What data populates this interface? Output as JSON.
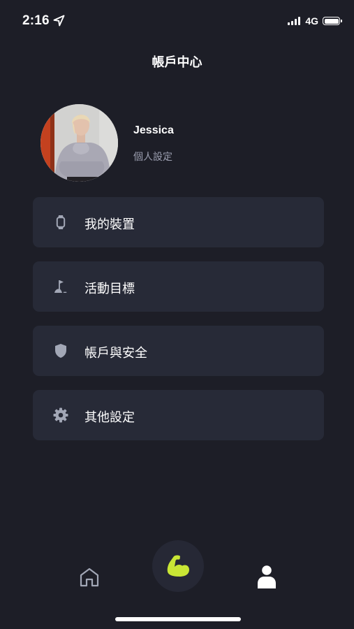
{
  "status_bar": {
    "time": "2:16",
    "network": "4G",
    "location_icon": "location-arrow-icon",
    "signal_icon": "signal-bars-icon",
    "battery_icon": "battery-icon",
    "battery_level": 1.0
  },
  "header": {
    "title": "帳戶中心"
  },
  "profile": {
    "name": "Jessica",
    "subtitle": "個人設定",
    "avatar_icon": "user-photo"
  },
  "menu": {
    "items": [
      {
        "label": "我的裝置",
        "icon": "smartwatch-icon"
      },
      {
        "label": "活動目標",
        "icon": "flag-goal-icon"
      },
      {
        "label": "帳戶與安全",
        "icon": "shield-icon"
      },
      {
        "label": "其他設定",
        "icon": "gear-icon"
      }
    ]
  },
  "tab_bar": {
    "items": [
      {
        "icon": "home-icon",
        "active": false
      },
      {
        "icon": "flexed-arm-icon",
        "active": false
      },
      {
        "icon": "person-icon",
        "active": true
      }
    ]
  },
  "colors": {
    "background": "#1d1e27",
    "card": "#272a37",
    "accent": "#c9e635",
    "muted_text": "#9c9fb0",
    "inactive_icon": "#a2a7b6"
  }
}
